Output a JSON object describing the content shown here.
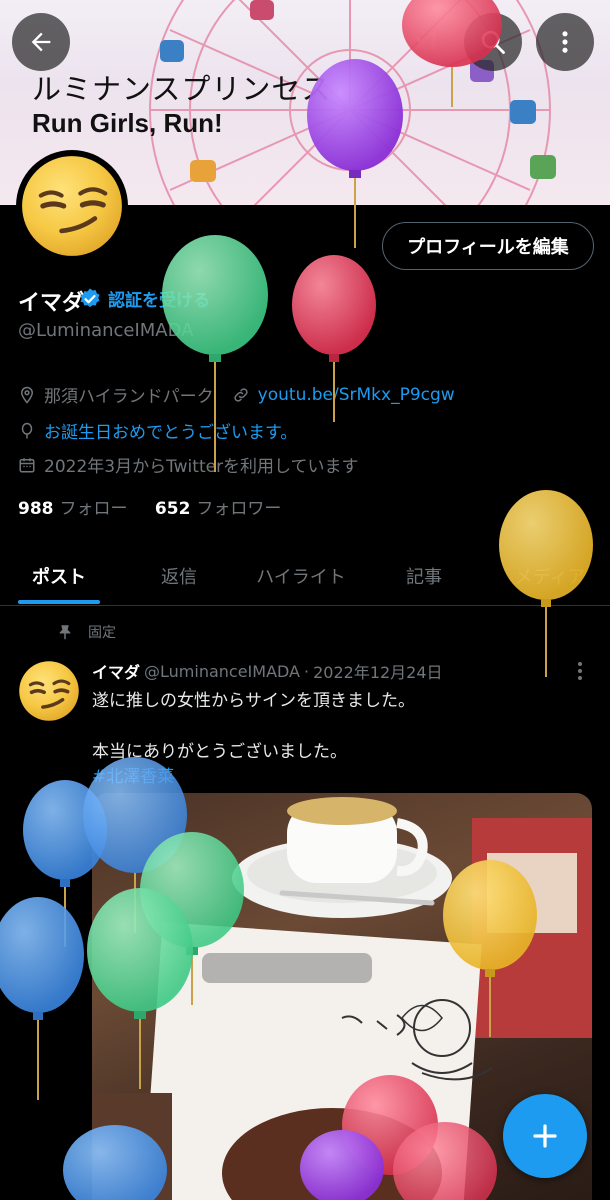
{
  "banner": {
    "line1": "ルミナンスプリンセス",
    "line2": "Run Girls, Run!"
  },
  "top_bar": {
    "back_icon": "arrow-left-icon",
    "grok_label": "xI",
    "search_icon": "search-icon",
    "more_icon": "more-vertical-icon"
  },
  "profile": {
    "edit_label": "プロフィールを編集",
    "name": "イマダ",
    "verify_label": "認証を受ける",
    "handle": "@LuminanceIMADA",
    "location": "那須ハイランドパーク",
    "website": "youtu.be/SrMkx_P9cgw",
    "birthday_text": "お誕生日おめでとうございます。",
    "joined": "2022年3月からTwitterを利用しています",
    "following_count": "988",
    "following_label": "フォロー",
    "followers_count": "652",
    "followers_label": "フォロワー"
  },
  "tabs": [
    "ポスト",
    "返信",
    "ハイライト",
    "記事",
    "メディア"
  ],
  "post": {
    "pinned_label": "固定",
    "author": "イマダ",
    "handle": "@LuminanceIMADA",
    "sep": "·",
    "date": "2022年12月24日",
    "line1": "遂に推しの女性からサインを頂きました。",
    "line2": "本当にありがとうございました。",
    "hashtag": "#北澤香菜"
  },
  "colors": {
    "accent": "#1d9bf0",
    "background": "#000000",
    "secondary_text": "#71767b"
  },
  "fab_icon": "plus-icon"
}
